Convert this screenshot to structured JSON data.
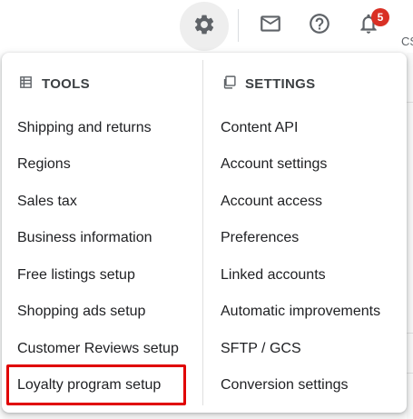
{
  "toolbar": {
    "gear": "gear-icon",
    "mail": "mail-icon",
    "help": "help-icon",
    "bell": "bell-icon",
    "notification_count": "5",
    "edge_text": "CS"
  },
  "menu": {
    "tools": {
      "heading": "TOOLS",
      "icon": "table-icon",
      "items": [
        "Shipping and returns",
        "Regions",
        "Sales tax",
        "Business information",
        "Free listings setup",
        "Shopping ads setup",
        "Customer Reviews setup",
        "Loyalty program setup"
      ]
    },
    "settings": {
      "heading": "SETTINGS",
      "icon": "copy-icon",
      "items": [
        "Content API",
        "Account settings",
        "Account access",
        "Preferences",
        "Linked accounts",
        "Automatic improvements",
        "SFTP / GCS",
        "Conversion settings"
      ]
    }
  },
  "highlight_color": "#e00000",
  "badge_color": "#d93025"
}
